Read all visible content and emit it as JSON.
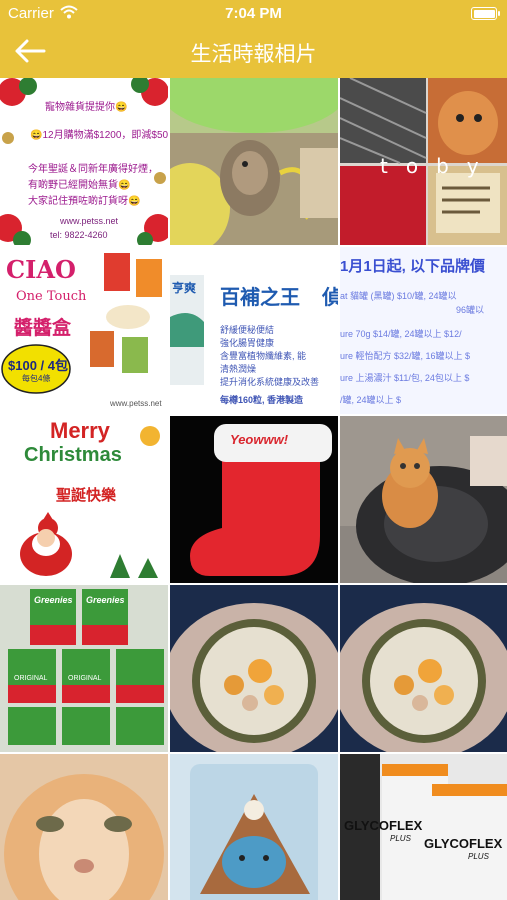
{
  "status_bar": {
    "carrier": "Carrier",
    "time": "7:04 PM"
  },
  "nav": {
    "title": "生活時報相片",
    "back_icon": "arrow-left-icon"
  },
  "colors": {
    "header": "#e8c23a",
    "header_text": "#ffffff"
  },
  "photos": [
    {
      "name": "promo-notice",
      "lines": [
        "寵物雜貨提提你😄",
        "😄12月購物滿$1200，即減$50😄",
        "今年聖誕＆同新年廣得好煙，",
        "有啲野已經開始無貨😄",
        "大家記住預咗啲訂貨呀😄"
      ],
      "footer": "www.petss.net",
      "phone": "tel: 9822-4260"
    },
    {
      "name": "hamster-photo"
    },
    {
      "name": "toby-cat-collage",
      "caption": "toby"
    },
    {
      "name": "ciao-product-ad",
      "brand": "CIAO",
      "subbrand": "One Touch",
      "product": "醬醬盒",
      "price": "$100 / 4包",
      "price_note": "每包4條",
      "footer": "www.petss.net"
    },
    {
      "name": "supplement-ad",
      "title": "百補之王",
      "title_tail": "偵",
      "side": "亨爽",
      "lines": [
        "舒緩便秘便結",
        "強化腸胃健康",
        "含豐富植物纖維素, 能",
        "清熱潤燥",
        "提升消化系統健康及改善"
      ],
      "footer": "每樽160粒, 香港製造"
    },
    {
      "name": "price-list",
      "title": "1月1日起, 以下品牌價",
      "lines": [
        "at 貓罐 (黑罐) $10/罐, 24罐以",
        "96罐以",
        "ure 70g $14/罐, 24罐以上 $12/",
        "ure 輕怡配方 $32/罐, 16罐以上 $",
        "ure 上湯濃汁 $11/包, 24包以上 $",
        "/罐, 24罐以上 $"
      ]
    },
    {
      "name": "merry-christmas-card",
      "line1": "Merry",
      "line2": "Christmas",
      "greeting": "聖誕快樂"
    },
    {
      "name": "christmas-stocking-toy",
      "tag": "Yeowww!"
    },
    {
      "name": "orange-cat-on-bed"
    },
    {
      "name": "greenies-treats-shelf",
      "brand": "Greenies",
      "label": "ORIGINAL"
    },
    {
      "name": "cat-food-bowl-1"
    },
    {
      "name": "cat-food-bowl-2"
    },
    {
      "name": "orange-cat-closeup"
    },
    {
      "name": "cat-toy-cookie"
    },
    {
      "name": "glycoflex-packs",
      "brand": "GLYCOFLEX",
      "plus": "PLUS"
    }
  ]
}
